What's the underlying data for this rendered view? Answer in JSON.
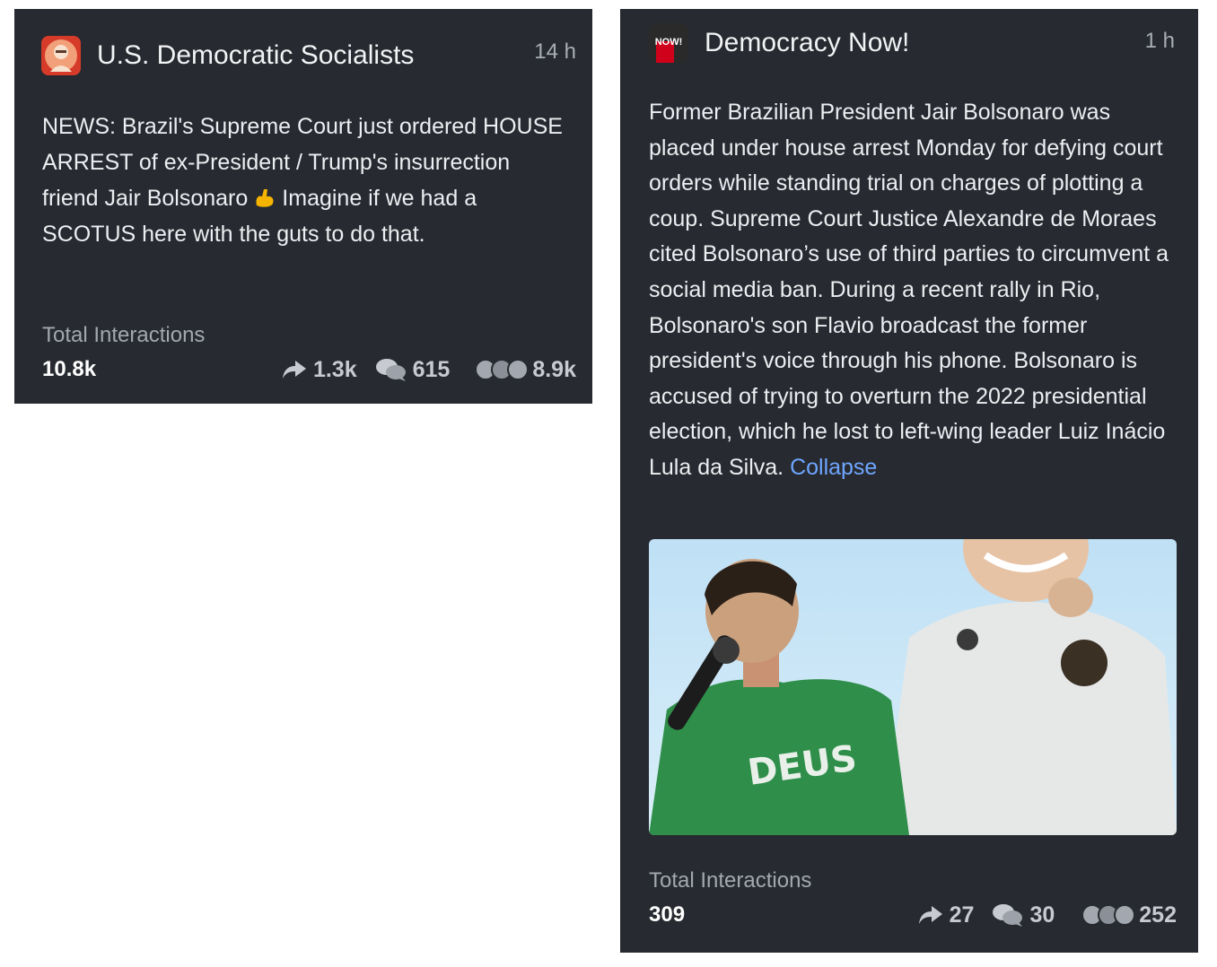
{
  "posts": [
    {
      "source": "U.S. Democratic Socialists",
      "avatar_icon": "red-portrait-avatar-icon",
      "time": "14 h",
      "text_part1": "NEWS: Brazil's Supreme Court just ordered HOUSE ARREST of ex-President / Trump's insurrection friend Jair Bolsonaro",
      "emoji": "flexed-biceps-emoji",
      "text_part2": "Imagine if we had a SCOTUS here with the guts to do that.",
      "total_label": "Total Interactions",
      "total": "10.8k",
      "shares": "1.3k",
      "comments": "615",
      "reactions": "8.9k"
    },
    {
      "source": "Democracy Now!",
      "avatar_icon": "democracy-now-logo-icon",
      "avatar_text": "NOW!",
      "time": "1 h",
      "text": "Former Brazilian President Jair Bolsonaro was placed under house arrest Monday for defying court orders while standing trial on charges of plotting a coup. Supreme Court Justice Alexandre de Moraes cited Bolsonaro’s use of third parties to circumvent a social media ban. During a recent rally in Rio, Bolsonaro's son Flavio broadcast the former president's voice through his phone. Bolsonaro is accused of trying to overturn the 2022 presidential election, which he lost to left-wing leader Luiz Inácio Lula da Silva.",
      "collapse": "Collapse",
      "photo_shirt_text": "DEUS",
      "total_label": "Total Interactions",
      "total": "309",
      "shares": "27",
      "comments": "30",
      "reactions": "252"
    }
  ],
  "colors": {
    "card_bg": "#272a30",
    "link": "#6ea6ff",
    "muted": "#a3a8b0"
  }
}
